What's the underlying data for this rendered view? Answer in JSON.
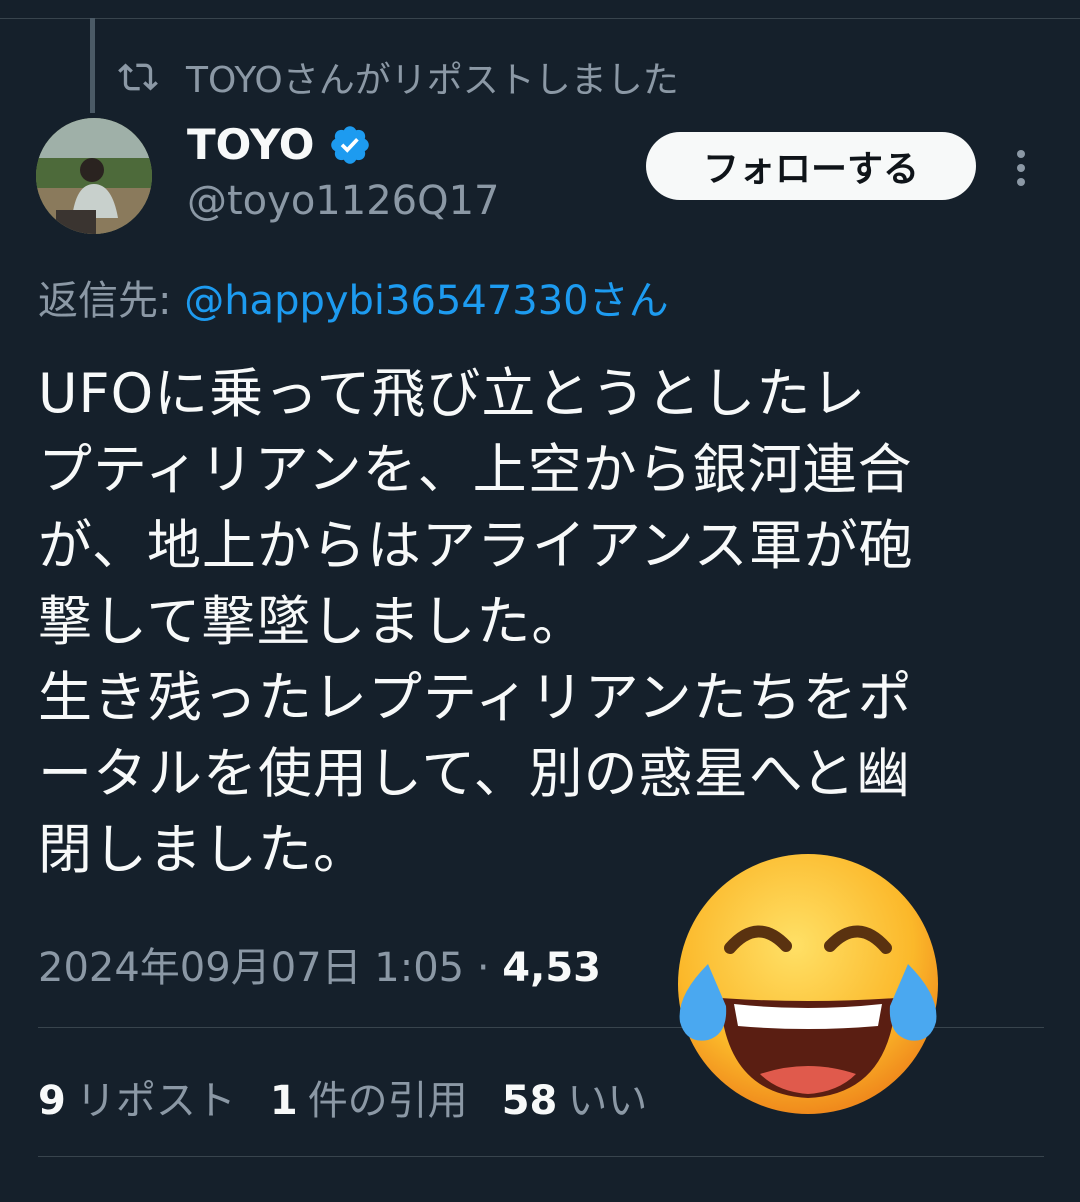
{
  "repost_banner": {
    "text": "TOYOさんがリポストしました",
    "icon": "repost-icon"
  },
  "author": {
    "name": "TOYO",
    "handle": "@toyo1126Q17",
    "verified_icon": "verified-badge-icon",
    "avatar": "profile-photo"
  },
  "follow_button": {
    "label": "フォローする"
  },
  "more_menu": {
    "icon": "more-vertical-icon"
  },
  "reply_to": {
    "prefix": "返信先: ",
    "mention": "@happybi36547330さん"
  },
  "tweet": {
    "text": "UFOに乗って飛び立とうとしたレ\nプティリアンを、上空から銀河連合\nが、地上からはアライアンス軍が砲\n撃して撃墜しました。\n生き残ったレプティリアンたちをポ\nータルを使用して、別の惑星へと幽\n閉しました。"
  },
  "meta": {
    "timestamp": "2024年09月07日 1:05",
    "separator": " · ",
    "views_partial": "4,53"
  },
  "stats": {
    "reposts_count": "9",
    "reposts_label": "リポスト",
    "quotes_count": "1",
    "quotes_label": "件の引用",
    "likes_count": "58",
    "likes_label_partial": "いい"
  },
  "overlay": {
    "emoji": "face-with-tears-of-joy-icon"
  },
  "colors": {
    "background": "#15202b",
    "accent": "#1d9bf0",
    "muted": "#8b98a5",
    "text": "#f7f9f9"
  }
}
